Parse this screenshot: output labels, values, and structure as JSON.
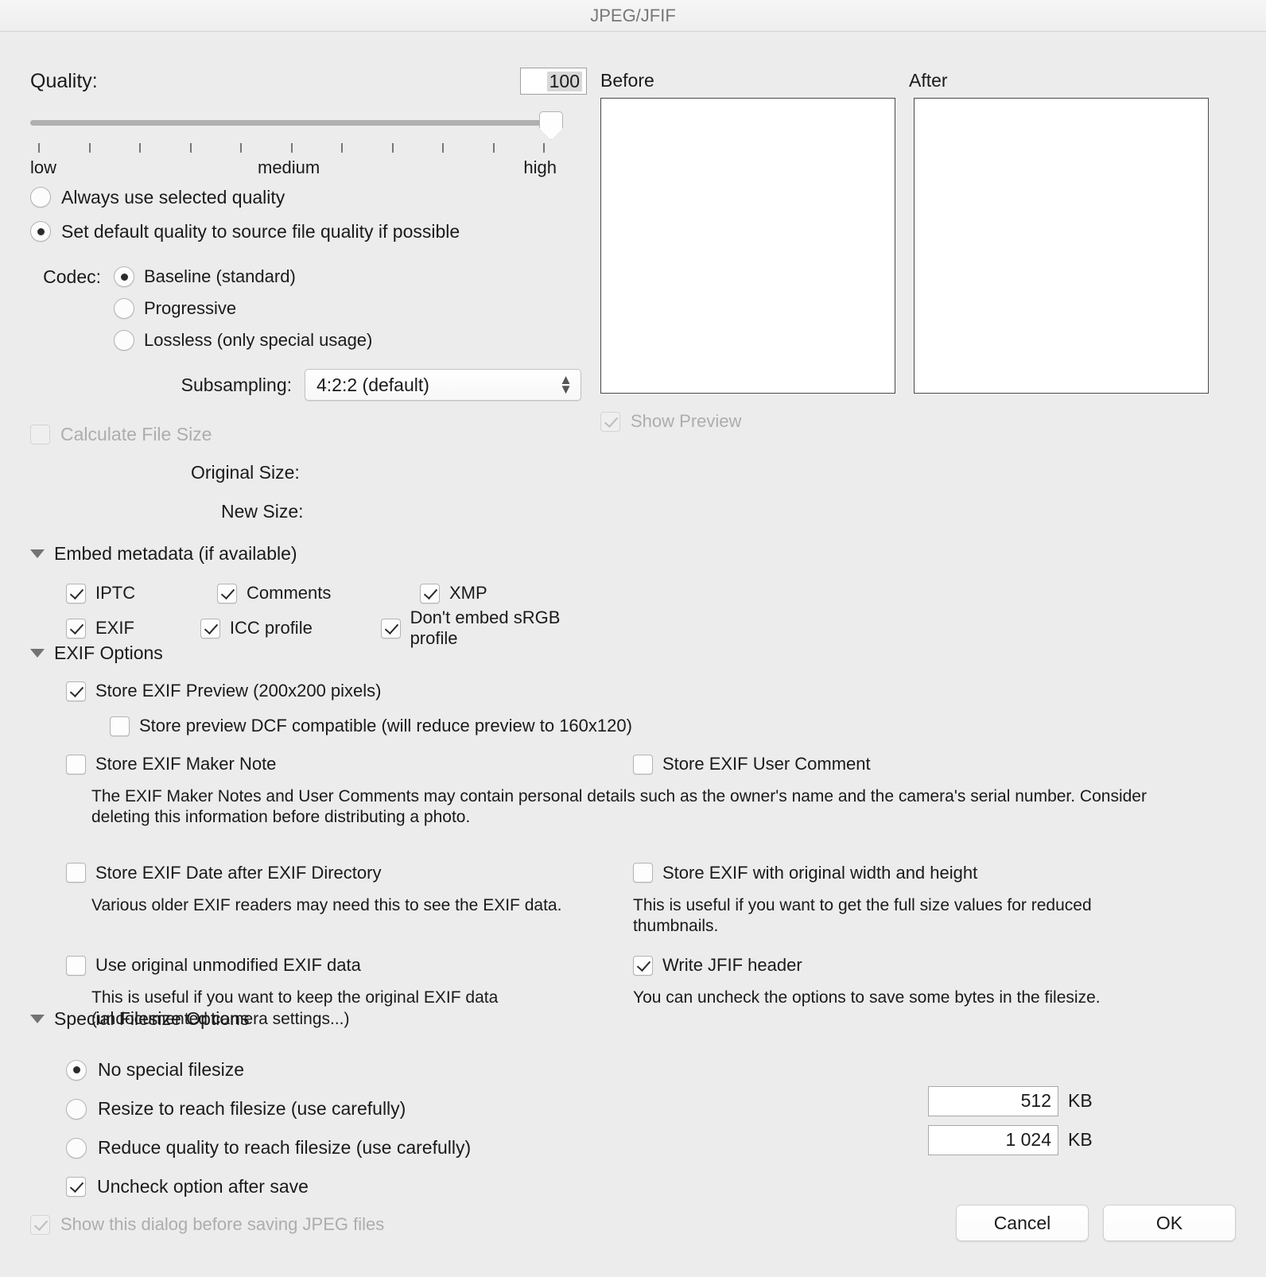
{
  "window": {
    "title": "JPEG/JFIF"
  },
  "quality": {
    "label": "Quality:",
    "value": "100",
    "slider_low": "low",
    "slider_medium": "medium",
    "slider_high": "high",
    "tick_count": 11
  },
  "quality_mode": {
    "always_use_selected": "Always use selected quality",
    "set_default_source": "Set default quality to source file quality if possible",
    "selected": "set_default_source"
  },
  "codec": {
    "label": "Codec:",
    "options": [
      {
        "label": "Baseline (standard)",
        "checked": true
      },
      {
        "label": "Progressive",
        "checked": false
      },
      {
        "label": "Lossless (only special usage)",
        "checked": false
      }
    ]
  },
  "subsampling": {
    "label": "Subsampling:",
    "value": "4:2:2 (default)"
  },
  "calculate_file_size": {
    "label": "Calculate File Size",
    "checked": false,
    "disabled": true
  },
  "sizes": {
    "original": "Original Size:",
    "new": "New Size:"
  },
  "embed_metadata": {
    "header": "Embed metadata (if available)",
    "items": [
      {
        "label": "IPTC",
        "checked": true
      },
      {
        "label": "Comments",
        "checked": true
      },
      {
        "label": "XMP",
        "checked": true
      },
      {
        "label": "EXIF",
        "checked": true
      },
      {
        "label": "ICC profile",
        "checked": true
      },
      {
        "label": "Don't embed sRGB profile",
        "checked": true
      }
    ]
  },
  "exif_options": {
    "header": "EXIF Options",
    "store_preview": {
      "label": "Store EXIF Preview (200x200 pixels)",
      "checked": true
    },
    "store_dcf": {
      "label": "Store preview DCF compatible (will reduce preview to 160x120)",
      "checked": false
    },
    "maker_note": {
      "label": "Store EXIF Maker Note",
      "checked": false
    },
    "user_comment": {
      "label": "Store EXIF User Comment",
      "checked": false
    },
    "maker_note_help": "The EXIF Maker Notes and User Comments may contain personal details such as the owner's name and the camera's serial number. Consider deleting this information before distributing a photo.",
    "date_after_dir": {
      "label": "Store EXIF Date after EXIF Directory",
      "checked": false
    },
    "date_after_dir_help": "Various older EXIF readers may need this to see the EXIF data.",
    "original_wh": {
      "label": "Store EXIF with original width and height",
      "checked": false
    },
    "original_wh_help": "This is useful if you want to get the full size values for reduced thumbnails.",
    "unmodified": {
      "label": "Use original unmodified EXIF data",
      "checked": false
    },
    "unmodified_help": "This is useful if you want to keep the original EXIF data (undocumented camera settings...)",
    "jfif_header": {
      "label": "Write JFIF header",
      "checked": true
    },
    "jfif_header_help": "You can uncheck the options to save some bytes in the filesize."
  },
  "special_filesize": {
    "header": "Special Filesize Options",
    "options": [
      {
        "label": "No special filesize",
        "checked": true
      },
      {
        "label": "Resize to reach filesize (use carefully)",
        "checked": false
      },
      {
        "label": "Reduce quality to reach filesize (use carefully)",
        "checked": false
      }
    ],
    "uncheck_after_save": {
      "label": "Uncheck option after save",
      "checked": true
    },
    "resize_value": "512",
    "resize_unit": "KB",
    "reduce_value": "1 024",
    "reduce_unit": "KB"
  },
  "preview": {
    "before_label": "Before",
    "after_label": "After",
    "show_preview": {
      "label": "Show Preview",
      "checked": true,
      "disabled": true
    }
  },
  "footer": {
    "show_dialog": {
      "label": "Show this dialog before saving JPEG files",
      "checked": true,
      "disabled": true
    },
    "cancel": "Cancel",
    "ok": "OK"
  }
}
